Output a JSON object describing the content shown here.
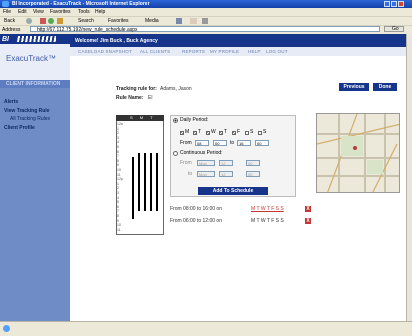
{
  "window": {
    "title": "BI Incorporated - ExacuTrack - Microsoft Internet Explorer",
    "menu": [
      "File",
      "Edit",
      "View",
      "Favorites",
      "Tools",
      "Help"
    ],
    "toolbar": [
      "Back",
      "Search",
      "Favorites",
      "Media"
    ],
    "address_label": "Address",
    "address": "http://67.112.75.192/new_rule_schedule.aspx",
    "go_label": "Go"
  },
  "sidebar": {
    "logo": "BI",
    "product": "ExacuTrack™",
    "section": "CLIENT INFORMATION",
    "items": [
      {
        "label": "Alerts"
      },
      {
        "label": "View Tracking Rule"
      },
      {
        "label": "All Tracking Rules"
      },
      {
        "label": "Client Profile"
      }
    ]
  },
  "header": {
    "welcome": "Welcome! Jim Buck , Buck Agency",
    "nav": [
      "CASELOAD SNAPSHOT",
      "ALL CLIENTS",
      "REPORTS",
      "MY PROFILE",
      "HELP",
      "LOG OUT"
    ]
  },
  "main": {
    "tracking_label": "Tracking rule for:",
    "client": "Adams, Jason",
    "rule_label": "Rule Name:",
    "rule_name": "El",
    "previous_label": "Previous",
    "done_label": "Done",
    "grid_days": "S M T W T F S",
    "grid_rows": [
      "12a",
      "1",
      "2",
      "3",
      "4",
      "5",
      "6",
      "7",
      "8",
      "9",
      "10",
      "11",
      "12p",
      "1",
      "2",
      "3",
      "4",
      "5",
      "6",
      "7",
      "8",
      "9",
      "10",
      "11"
    ],
    "daily_label": "Daily Period:",
    "days": [
      "M",
      "T",
      "W",
      "T",
      "F",
      "S",
      "S"
    ],
    "from_label": "From",
    "to_label": "to",
    "from_values": [
      "08",
      "00",
      "AM"
    ],
    "to_values": [
      "16",
      "00",
      "PM"
    ],
    "continuous_label": "Continuous Period:",
    "cont_from": [
      "Mon",
      "12",
      "00"
    ],
    "cont_to": [
      "Mon",
      "12",
      "00"
    ],
    "add_label": "Add To Schedule",
    "schedules": [
      {
        "prefix": "From 08:00 to 16:00 on",
        "days": "M T W T F S S"
      },
      {
        "prefix": "From 06:00 to 12:00 on",
        "days": "M T W T F S S"
      }
    ],
    "remove_glyph": "X"
  },
  "colors": {
    "header_blue": "#16348a",
    "sidebar_blue": "#6f8cc6",
    "link_red": "#c43636"
  }
}
